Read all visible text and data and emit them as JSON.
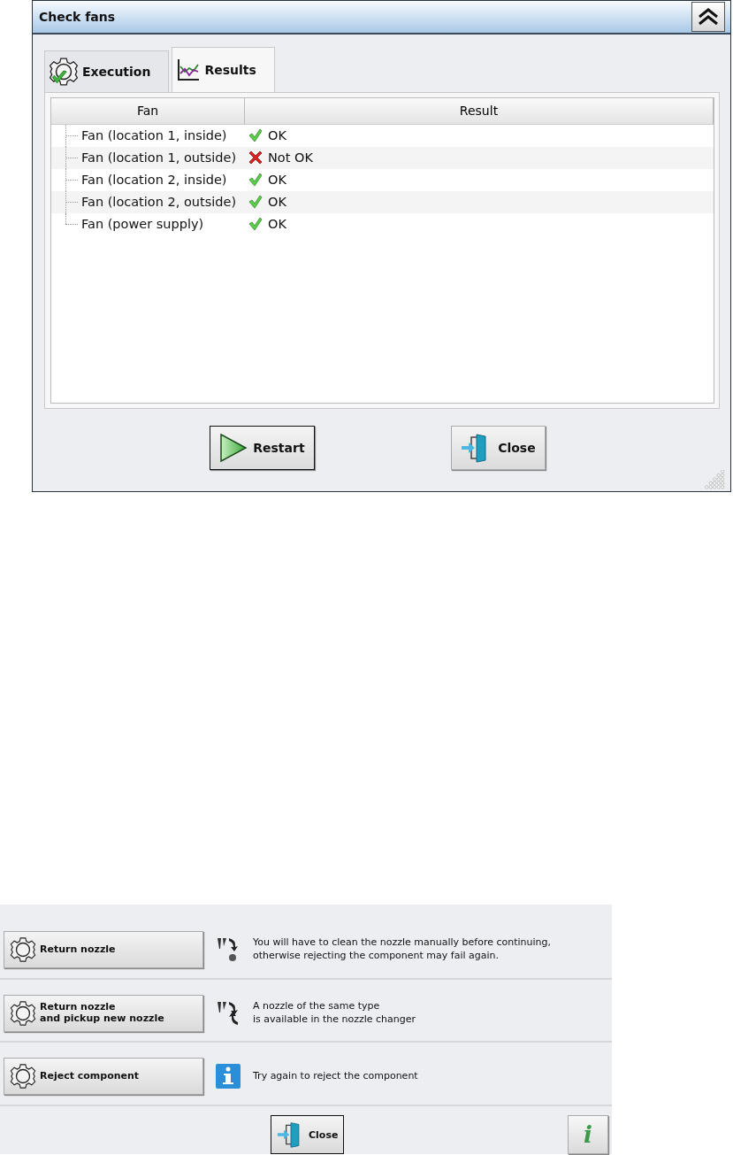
{
  "dialog": {
    "title": "Check fans",
    "tabs": [
      {
        "label": "Execution",
        "selected": false,
        "kind": "execution"
      },
      {
        "label": "Results",
        "selected": true,
        "kind": "results"
      }
    ],
    "table": {
      "columns": [
        "Fan",
        "Result"
      ],
      "rows": [
        {
          "fan": "Fan (location 1, inside)",
          "passed": true,
          "result": "OK"
        },
        {
          "fan": "Fan (location 1, outside)",
          "passed": false,
          "result": "Not OK"
        },
        {
          "fan": "Fan (location 2, inside)",
          "passed": true,
          "result": "OK"
        },
        {
          "fan": "Fan (location 2, outside)",
          "passed": true,
          "result": "OK"
        },
        {
          "fan": "Fan (power supply)",
          "passed": true,
          "result": "OK"
        }
      ]
    },
    "buttons": [
      {
        "label": "Restart",
        "kind": "play",
        "focused": true
      },
      {
        "label": "Close",
        "kind": "exit",
        "focused": false
      }
    ]
  },
  "options_panel": {
    "options": [
      {
        "label": [
          "Return nozzle"
        ],
        "kind": "nozzle-return",
        "info": [
          "You will have to clean the nozzle manually before continuing,",
          "otherwise rejecting the component may fail again."
        ]
      },
      {
        "label": [
          "Return nozzle",
          "and pickup new nozzle"
        ],
        "kind": "nozzle-swap",
        "info": [
          "A nozzle of the same type",
          "is available in the nozzle changer"
        ]
      },
      {
        "label": [
          "Reject component"
        ],
        "kind": "info",
        "info": [
          "Try again to reject the component"
        ]
      }
    ],
    "close": {
      "label": "Close",
      "focused": true
    },
    "help": {
      "label": "i"
    }
  }
}
